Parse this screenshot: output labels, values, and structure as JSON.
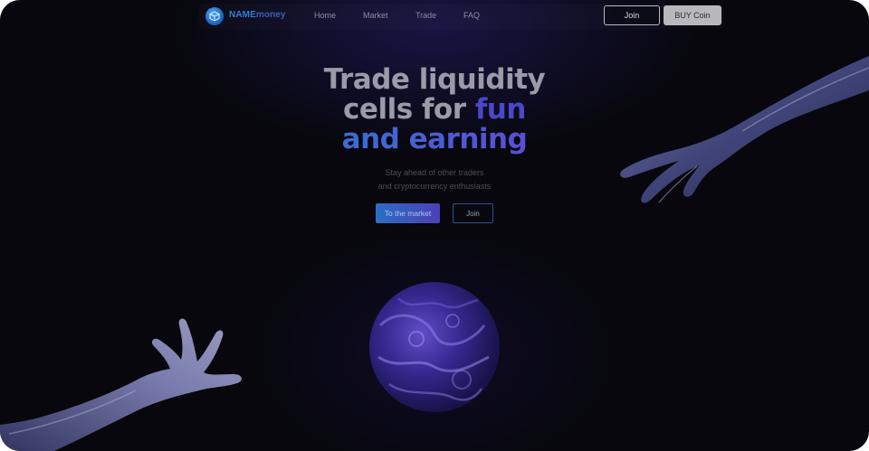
{
  "nav": {
    "brand": "NAME",
    "brand_suffix": "money",
    "links": [
      "Home",
      "Market",
      "Trade",
      "FAQ"
    ],
    "join_label": "Join",
    "buy_label": "BUY Coin"
  },
  "hero": {
    "title_line1": "Trade liquidity",
    "title_line2_a": "cells for ",
    "title_line2_b": "fun",
    "title_line3": "and earning",
    "subtitle_line1": "Stay ahead of other traders",
    "subtitle_line2": "and cryptocurrency enthusiasts",
    "primary_cta": "To the market",
    "secondary_cta": "Join"
  },
  "colors": {
    "background": "#07070d",
    "accent_blue": "#2b7bd0",
    "accent_purple": "#6a3fd6"
  }
}
